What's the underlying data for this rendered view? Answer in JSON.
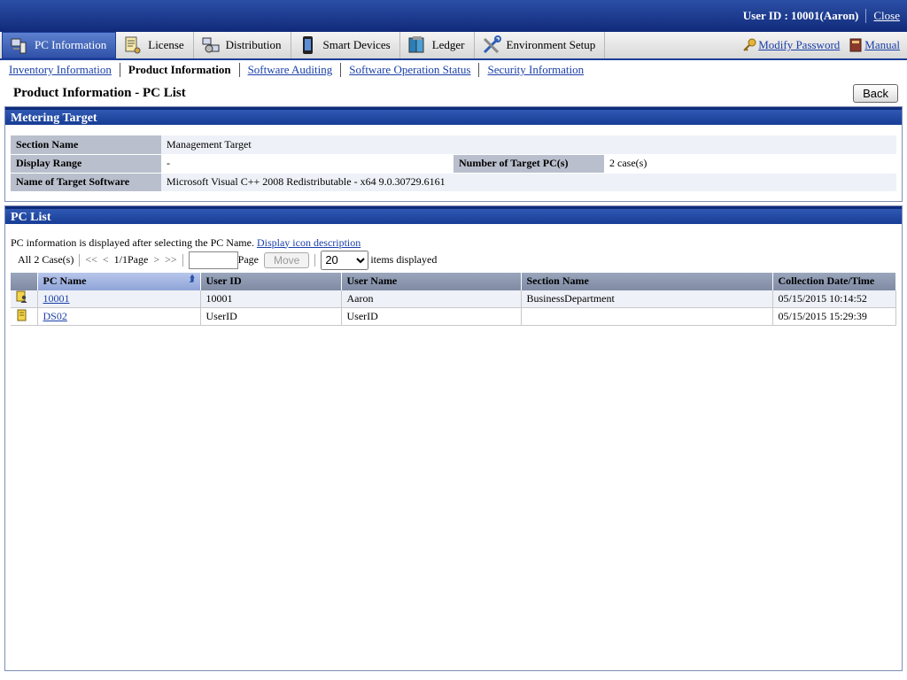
{
  "top": {
    "user_label": "User ID : 10001(Aaron)",
    "close_label": "Close"
  },
  "tabs": [
    {
      "label": "PC Information",
      "icon": "pc-icon",
      "active": true
    },
    {
      "label": "License",
      "icon": "license-icon"
    },
    {
      "label": "Distribution",
      "icon": "distribution-icon"
    },
    {
      "label": "Smart Devices",
      "icon": "smart-device-icon"
    },
    {
      "label": "Ledger",
      "icon": "ledger-icon"
    },
    {
      "label": "Environment Setup",
      "icon": "tools-icon"
    }
  ],
  "tabbar_right": {
    "modify_password": "Modify Password",
    "manual": "Manual"
  },
  "subnav": [
    {
      "label": "Inventory Information"
    },
    {
      "label": "Product Information",
      "current": true
    },
    {
      "label": "Software Auditing"
    },
    {
      "label": "Software Operation Status"
    },
    {
      "label": "Security Information"
    }
  ],
  "page": {
    "title": "Product Information - PC List",
    "back_label": "Back"
  },
  "metering": {
    "title": "Metering Target",
    "section_name_label": "Section Name",
    "section_name_value": "Management Target",
    "display_range_label": "Display Range",
    "display_range_value": "-",
    "num_target_label": "Number of Target PC(s)",
    "num_target_value": "2 case(s)",
    "target_software_label": "Name of Target Software",
    "target_software_value": "Microsoft Visual C++ 2008 Redistributable - x64 9.0.30729.6161"
  },
  "pclist": {
    "title": "PC List",
    "description": "PC information is displayed after selecting the PC Name.",
    "icon_desc_link": "Display icon description",
    "pager": {
      "all_cases": "All 2 Case(s)",
      "first": "<<",
      "prev": "<",
      "page_info": "1/1Page",
      "next": ">",
      "last": ">>",
      "page_label": "Page",
      "move_label": "Move",
      "per_page": "20",
      "items_displayed": "items displayed"
    },
    "columns": [
      "PC Name",
      "User ID",
      "User Name",
      "Section Name",
      "Collection Date/Time"
    ],
    "rows": [
      {
        "pc_name": "10001",
        "user_id": "10001",
        "user_name": "Aaron",
        "section": "BusinessDepartment",
        "datetime": "05/15/2015 10:14:52",
        "icon": "pc-user-icon"
      },
      {
        "pc_name": "DS02",
        "user_id": "UserID",
        "user_name": "UserID",
        "section": "",
        "datetime": "05/15/2015 15:29:39",
        "icon": "pc-icon"
      }
    ]
  }
}
